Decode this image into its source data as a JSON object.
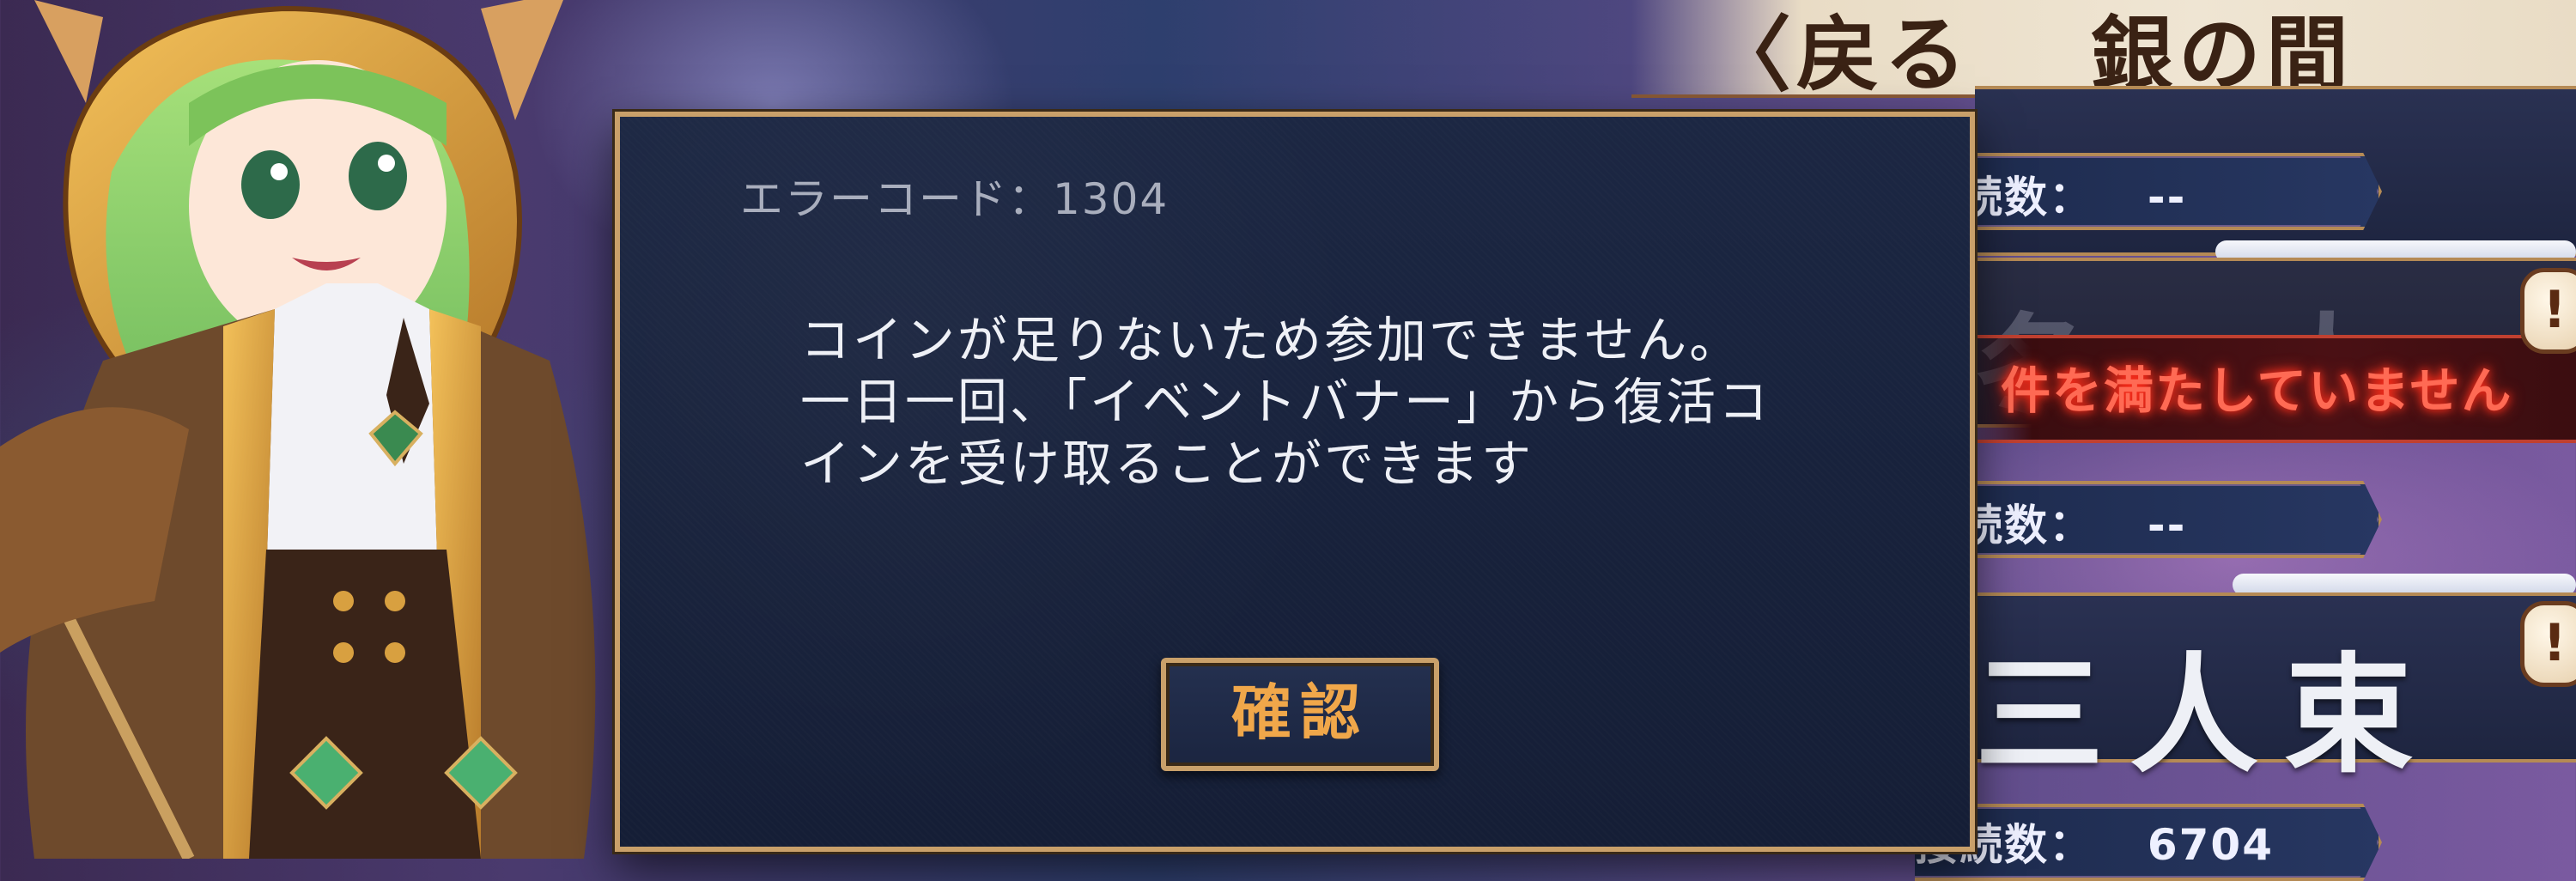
{
  "header": {
    "back_label": "〈戻る",
    "title": "銀の間"
  },
  "dialog": {
    "error_code": "エラーコード：1304",
    "message": "コインが足りないため参加できません。一日一回、「イベントバナー」から復活コインを受け取ることができます",
    "confirm_label": "確認"
  },
  "event_list": {
    "items": [
      {
        "stat_label": "接続数：",
        "stat_value": "--"
      },
      {
        "warning": "件を満たしていません"
      },
      {
        "stat_label": "接続数：",
        "stat_value": "--"
      },
      {
        "calligraphy": "三人束"
      },
      {
        "stat_label": "接続数：",
        "stat_value": "6704"
      }
    ],
    "warning_icon_glyph": "!"
  },
  "colors": {
    "accent_gold": "#c9a06a",
    "button_text": "#f0a74a",
    "warning_red": "#ff6a54",
    "dialog_bg": "#1c2743"
  }
}
